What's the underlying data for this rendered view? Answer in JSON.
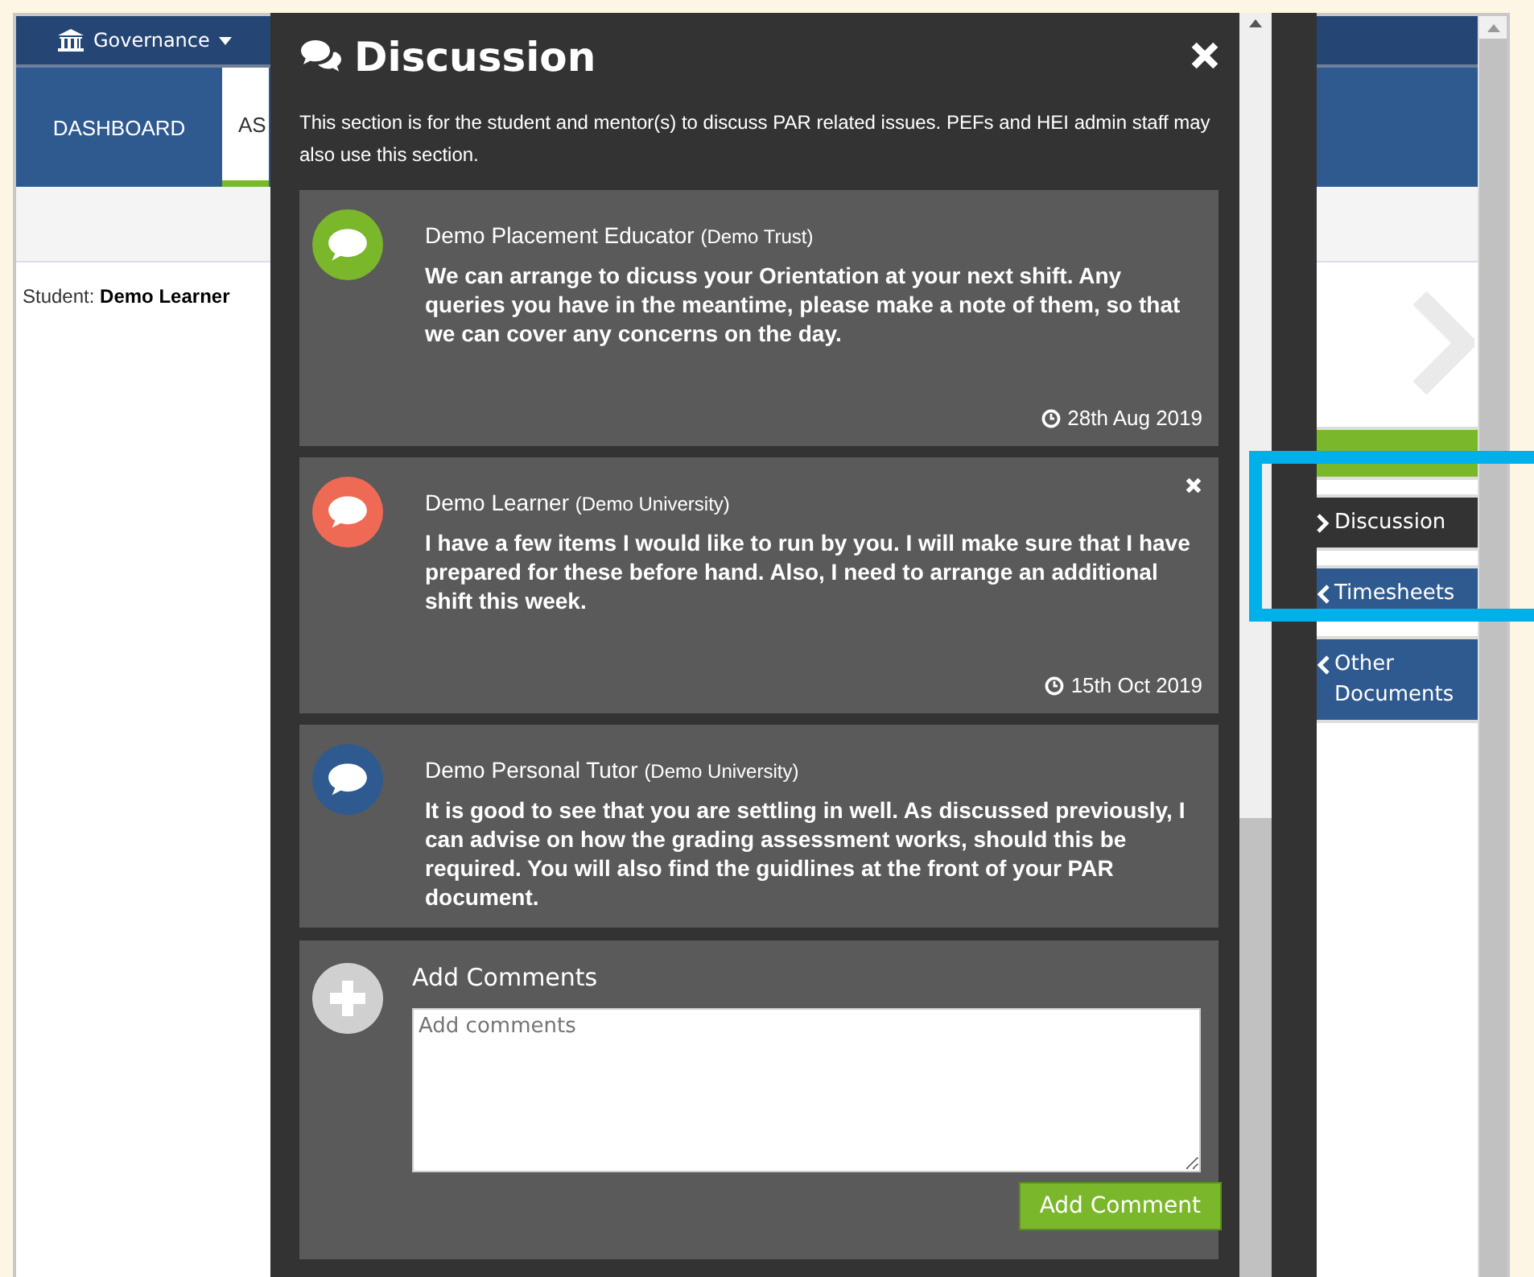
{
  "navbar": {
    "menu": "Governance"
  },
  "tabs": [
    {
      "label": "DASHBOARD",
      "selected": false
    },
    {
      "label": "AS",
      "selected": true
    }
  ],
  "student": {
    "label": "Student:",
    "name": "Demo Learner"
  },
  "side_tabs": [
    {
      "kind": "green",
      "selected": false
    },
    {
      "label": "Discussion",
      "kind": "blue",
      "selected": true
    },
    {
      "label": "Timesheets",
      "kind": "blue",
      "selected": false
    },
    {
      "label": "Other Documents",
      "kind": "blue",
      "selected": false
    }
  ],
  "discussion": {
    "title": "Discussion",
    "description": "This section is for the student and mentor(s) to discuss PAR related issues. PEFs and HEI admin staff may also use this section.",
    "messages": [
      {
        "author": "Demo Placement Educator",
        "org": "(Demo Trust)",
        "color": "#7ab72a",
        "deletable": false,
        "body": "We can arrange to dicuss your Orientation at your next shift. Any queries you have in the meantime, please make a note of them, so that we can cover any concerns on the day.",
        "date": "28th Aug 2019"
      },
      {
        "author": "Demo Learner",
        "org": "(Demo University)",
        "color": "#ef6a55",
        "deletable": true,
        "body": "I have a few items I would like to run by you. I will make sure that I have prepared for these before hand. Also, I need to arrange an additional shift this week.",
        "date": "15th Oct 2019"
      },
      {
        "author": "Demo Personal Tutor",
        "org": "(Demo University)",
        "color": "#2f5a8f",
        "deletable": false,
        "body": "It is good to see that you are settling in well. As discussed previously, I can advise on how the grading assessment works, should this be required. You will also find the guidlines at the front of your PAR document."
      }
    ],
    "add": {
      "heading": "Add Comments",
      "placeholder": "Add comments",
      "button": "Add Comment"
    }
  }
}
